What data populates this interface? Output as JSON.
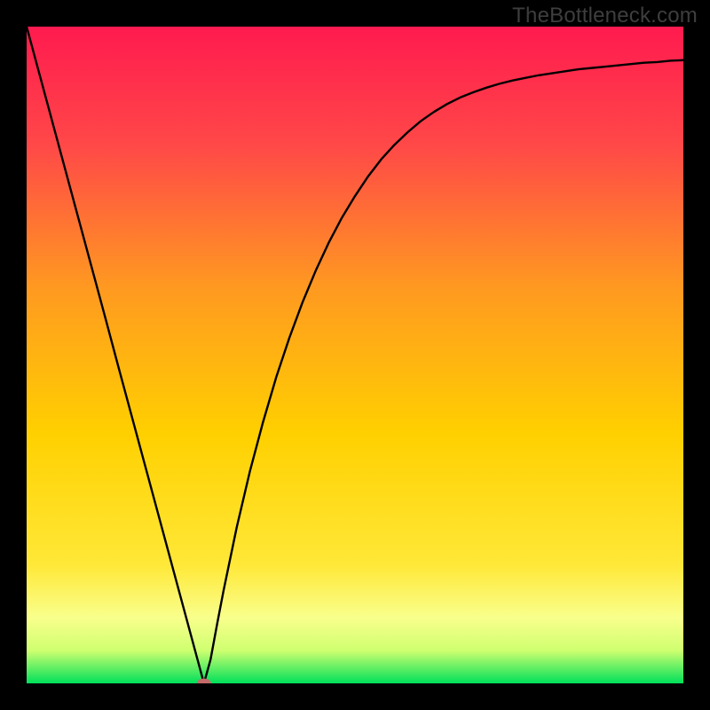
{
  "watermark": "TheBottleneck.com",
  "chart_data": {
    "type": "line",
    "title": "",
    "xlabel": "",
    "ylabel": "",
    "xlim": [
      0,
      100
    ],
    "ylim": [
      0,
      100
    ],
    "grid": false,
    "background_gradient": {
      "top": "#ff1a4f",
      "mid": "#ffd000",
      "bottom_band": "#f9ff8c",
      "base": "#00e05a"
    },
    "x": [
      0,
      2,
      4,
      6,
      8,
      10,
      12,
      14,
      16,
      18,
      20,
      22,
      24,
      26,
      27,
      28,
      29,
      30,
      32,
      34,
      36,
      38,
      40,
      42,
      44,
      46,
      48,
      50,
      52,
      54,
      56,
      58,
      60,
      62,
      64,
      66,
      68,
      70,
      72,
      74,
      76,
      78,
      80,
      82,
      84,
      86,
      88,
      90,
      92,
      94,
      96,
      98,
      100
    ],
    "values": [
      100,
      92.6,
      85.2,
      77.8,
      70.4,
      63.0,
      55.6,
      48.1,
      40.7,
      33.3,
      25.9,
      18.5,
      11.1,
      3.7,
      0.0,
      3.6,
      9.0,
      14.2,
      23.8,
      32.3,
      39.8,
      46.6,
      52.6,
      58.0,
      62.8,
      67.1,
      70.9,
      74.2,
      77.2,
      79.8,
      82.0,
      83.9,
      85.6,
      87.0,
      88.2,
      89.2,
      90.0,
      90.7,
      91.3,
      91.8,
      92.2,
      92.6,
      92.9,
      93.2,
      93.5,
      93.7,
      93.9,
      94.1,
      94.3,
      94.5,
      94.6,
      94.8,
      94.9
    ],
    "marker": {
      "x": 27,
      "y": 0,
      "color": "#c46a6a",
      "shape": "ellipse"
    }
  }
}
